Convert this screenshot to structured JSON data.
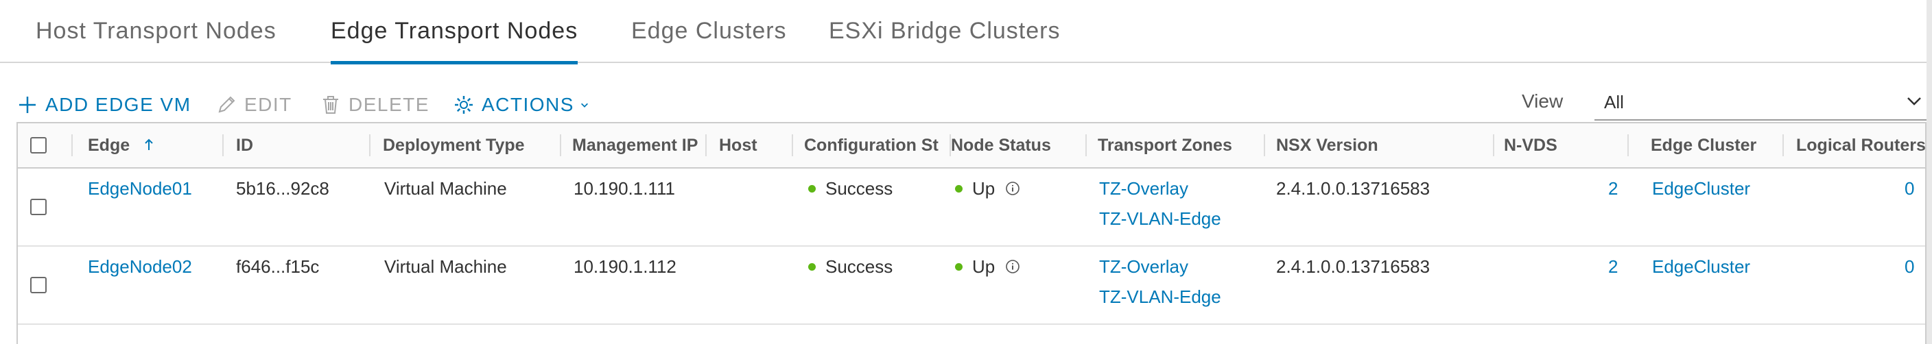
{
  "tabs": [
    {
      "label": "Host Transport Nodes",
      "active": false
    },
    {
      "label": "Edge Transport Nodes",
      "active": true
    },
    {
      "label": "Edge Clusters",
      "active": false
    },
    {
      "label": "ESXi Bridge Clusters",
      "active": false
    }
  ],
  "toolbar": {
    "add_label": "ADD EDGE VM",
    "edit_label": "EDIT",
    "delete_label": "DELETE",
    "actions_label": "ACTIONS",
    "view_label": "View",
    "view_value": "All"
  },
  "grid": {
    "columns": [
      "Edge",
      "ID",
      "Deployment Type",
      "Management IP",
      "Host",
      "Configuration St",
      "Node Status",
      "Transport Zones",
      "NSX Version",
      "N-VDS",
      "Edge Cluster",
      "Logical Routers"
    ],
    "rows": [
      {
        "edge": "EdgeNode01",
        "id": "5b16...92c8",
        "deployment_type": "Virtual Machine",
        "management_ip": "10.190.1.111",
        "host": "",
        "configuration_state": "Success",
        "node_status": "Up",
        "transport_zones": [
          "TZ-Overlay",
          "TZ-VLAN-Edge"
        ],
        "nsx_version": "2.4.1.0.0.13716583",
        "nvds": "2",
        "edge_cluster": "EdgeCluster",
        "logical_routers": "0"
      },
      {
        "edge": "EdgeNode02",
        "id": "f646...f15c",
        "deployment_type": "Virtual Machine",
        "management_ip": "10.190.1.112",
        "host": "",
        "configuration_state": "Success",
        "node_status": "Up",
        "transport_zones": [
          "TZ-Overlay",
          "TZ-VLAN-Edge"
        ],
        "nsx_version": "2.4.1.0.0.13716583",
        "nvds": "2",
        "edge_cluster": "EdgeCluster",
        "logical_routers": "0"
      }
    ]
  },
  "icons": {
    "add": "plus-icon",
    "edit": "pencil-icon",
    "delete": "trash-icon",
    "actions": "gear-icon",
    "sort": "sort-ascending-icon",
    "status_info": "info-icon",
    "view_dropdown": "chevron-down-icon"
  },
  "colors": {
    "accent": "#0079b8",
    "success": "#5eb715",
    "disabled": "#a6a6a6"
  }
}
